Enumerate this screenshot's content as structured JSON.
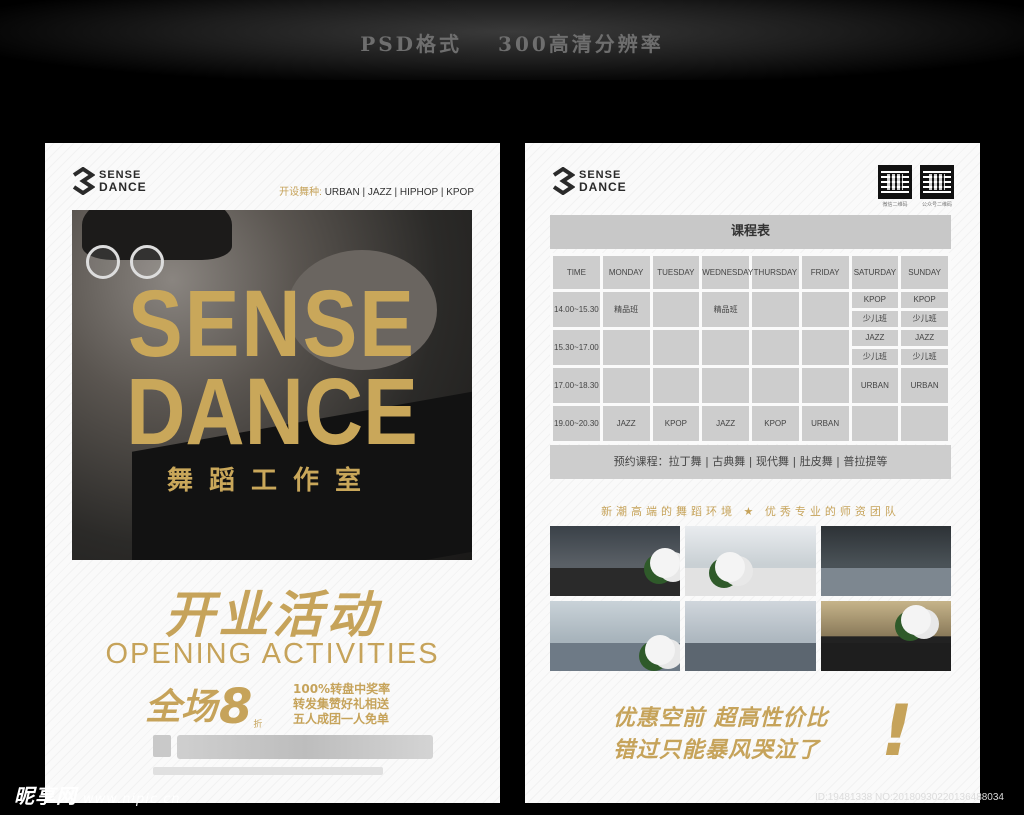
{
  "header": {
    "format": "PSD格式",
    "resolution": "300高清分辨率"
  },
  "left": {
    "logo": {
      "line1": "SENSE",
      "line2": "DANCE"
    },
    "styles_label": "开设舞种:",
    "styles": "URBAN | JAZZ | HIPHOP | KPOP",
    "photo_title1": "SENSE",
    "photo_title2": "DANCE",
    "photo_sub": "舞蹈工作室",
    "opening_cn": "开业活动",
    "opening_en": "OPENING ACTIVITIES",
    "promo_big": "全场",
    "promo_num": "8",
    "promo_unit": "折",
    "promo_items": [
      "100%转盘中奖率",
      "转发集赞好礼相送",
      "五人成团一人免单"
    ]
  },
  "right": {
    "logo": {
      "line1": "SENSE",
      "line2": "DANCE"
    },
    "qr_captions": [
      "微信二维码",
      "公众号二维码"
    ],
    "schedule_title": "课程表",
    "columns": [
      "TIME",
      "MONDAY",
      "TUESDAY",
      "WEDNESDAY",
      "THURSDAY",
      "FRIDAY",
      "SATURDAY",
      "SUNDAY"
    ],
    "rows": [
      {
        "time": "14.00~15.30",
        "cells": [
          "精品班",
          "",
          "精品班",
          "",
          "",
          [
            "KPOP",
            "少儿班"
          ],
          [
            "KPOP",
            "少儿班"
          ]
        ]
      },
      {
        "time": "15.30~17.00",
        "cells": [
          "",
          "",
          "",
          "",
          "",
          [
            "JAZZ",
            "少儿班"
          ],
          [
            "JAZZ",
            "少儿班"
          ]
        ]
      },
      {
        "time": "17.00~18.30",
        "cells": [
          "",
          "",
          "",
          "",
          "",
          "URBAN",
          "URBAN"
        ]
      },
      {
        "time": "19.00~20.30",
        "cells": [
          "JAZZ",
          "KPOP",
          "JAZZ",
          "KPOP",
          "URBAN",
          "",
          ""
        ]
      }
    ],
    "note": "预约课程：拉丁舞 | 古典舞 | 现代舞 | 肚皮舞 | 普拉提等",
    "environment": "新潮高端的舞蹈环境  ★  优秀专业的师资团队",
    "slogan1": "优惠空前 超高性价比",
    "slogan2": "错过只能暴风哭泣了",
    "exclaim": "!"
  },
  "watermark": {
    "brand": "昵享网",
    "url": "www.nipic.cn"
  },
  "image_id": "ID:19481338 NO:20180930220136488034"
}
